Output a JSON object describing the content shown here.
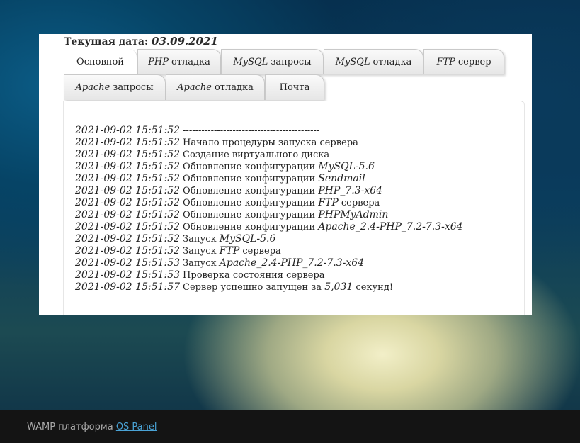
{
  "header": {
    "date_label": "Текущая дата:",
    "date_value": "03.09.2021"
  },
  "tabs": [
    {
      "prefix": "",
      "label": "Основной",
      "active": true
    },
    {
      "prefix": "PHP",
      "label": "отладка",
      "active": false
    },
    {
      "prefix": "MySQL",
      "label": "запросы",
      "active": false
    },
    {
      "prefix": "MySQL",
      "label": "отладка",
      "active": false
    },
    {
      "prefix": "FTP",
      "label": "сервер",
      "active": false
    },
    {
      "prefix": "Apache",
      "label": "запросы",
      "active": false
    },
    {
      "prefix": "Apache",
      "label": "отладка",
      "active": false
    },
    {
      "prefix": "",
      "label": "Почта",
      "active": false
    }
  ],
  "log": [
    {
      "ts": "2021-09-02 15:51:52",
      "text": "--------------------------------------------",
      "hl": "",
      "tail": ""
    },
    {
      "ts": "2021-09-02 15:51:52",
      "text": "Начало процедуры запуска сервера",
      "hl": "",
      "tail": ""
    },
    {
      "ts": "2021-09-02 15:51:52",
      "text": "Создание виртуального диска",
      "hl": "",
      "tail": ""
    },
    {
      "ts": "2021-09-02 15:51:52",
      "text": "Обновление конфигурации",
      "hl": "MySQL-5.6",
      "tail": ""
    },
    {
      "ts": "2021-09-02 15:51:52",
      "text": "Обновление конфигурации",
      "hl": "Sendmail",
      "tail": ""
    },
    {
      "ts": "2021-09-02 15:51:52",
      "text": "Обновление конфигурации",
      "hl": "PHP_7.3-x64",
      "tail": ""
    },
    {
      "ts": "2021-09-02 15:51:52",
      "text": "Обновление конфигурации",
      "hl": "FTP",
      "tail": "сервера"
    },
    {
      "ts": "2021-09-02 15:51:52",
      "text": "Обновление конфигурации",
      "hl": "PHPMyAdmin",
      "tail": ""
    },
    {
      "ts": "2021-09-02 15:51:52",
      "text": "Обновление конфигурации",
      "hl": "Apache_2.4-PHP_7.2-7.3-x64",
      "tail": ""
    },
    {
      "ts": "2021-09-02 15:51:52",
      "text": "Запуск",
      "hl": "MySQL-5.6",
      "tail": ""
    },
    {
      "ts": "2021-09-02 15:51:52",
      "text": "Запуск",
      "hl": "FTP",
      "tail": "сервера"
    },
    {
      "ts": "2021-09-02 15:51:53",
      "text": "Запуск",
      "hl": "Apache_2.4-PHP_7.2-7.3-x64",
      "tail": ""
    },
    {
      "ts": "2021-09-02 15:51:53",
      "text": "Проверка состояния сервера",
      "hl": "",
      "tail": ""
    },
    {
      "ts": "2021-09-02 15:51:57",
      "text": "Сервер успешно запущен за",
      "hl": "5,031",
      "tail": "секунд!"
    }
  ],
  "footer": {
    "text": "WAMP платформа",
    "link": "OS Panel"
  }
}
